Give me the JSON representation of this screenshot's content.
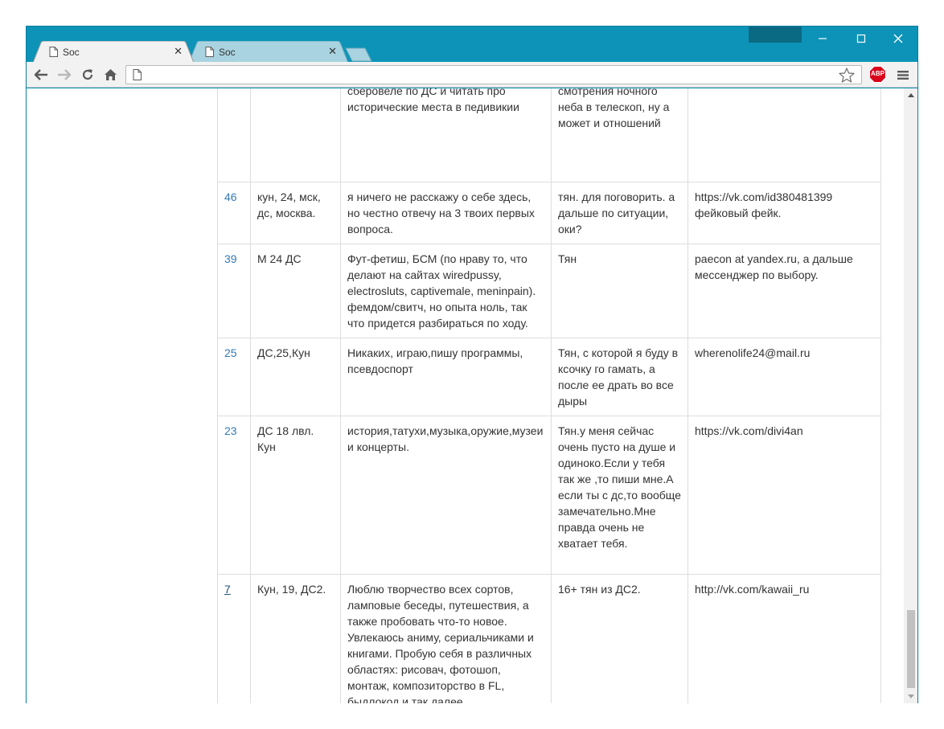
{
  "browser": {
    "tabs": [
      {
        "title": "Soc",
        "active": true
      },
      {
        "title": "Soc",
        "active": false
      }
    ],
    "new_tab_icon": "new-tab-icon",
    "address": {
      "value": "",
      "placeholder": ""
    },
    "adblock_label": "ABP",
    "colors": {
      "frame": "#0d93b8",
      "active_tab": "#f2f2f2",
      "inactive_tab": "#a9d3e0",
      "link": "#337ab7",
      "abp_red": "#d9001b"
    }
  },
  "table": {
    "rows": [
      {
        "id": "",
        "about": "",
        "interests": "музыка(гитарист), ездить на сберовеле по ДС и читать про исторические места в педивикии",
        "looking_for": "велопрогулок и смотрения ночного неба в телескоп, ну а может и отношений",
        "contact": ""
      },
      {
        "id": "46",
        "about": "кун, 24, мск, дс, москва.",
        "interests": "я ничего не расскажу о себе здесь, но честно отвечу на 3 твоих первых вопроса.",
        "looking_for": "тян. для поговорить. а дальше по ситуации, оки?",
        "contact": "https://vk.com/id380481399 фейковый фейк."
      },
      {
        "id": "39",
        "about": "М 24 ДС",
        "interests": "Фут-фетиш, БСМ (по нраву то, что делают на сайтах wiredpussy, electrosluts, captivemale, meninpain). фемдом/свитч, но опыта ноль, так что придется разбираться по ходу.",
        "looking_for": "Тян",
        "contact": "paecon at yandex.ru, а дальше мессенджер по выбору."
      },
      {
        "id": "25",
        "about": "ДС,25,Кун",
        "interests": "Никаких, играю,пишу программы, псевдоспорт",
        "looking_for": "Тян, с которой я буду в ксочку го гамать, а после ее драть во все дыры",
        "contact": "wherenolife24@mail.ru"
      },
      {
        "id": "23",
        "about": "ДС 18 лвл. Кун",
        "interests": "история,татухи,музыка,оружие,музеи и концерты.",
        "looking_for": "Тян.у меня сейчас очень пусто на душе и одиноко.Если у тебя так же ,то пиши мне.А если ты с дс,то вообще замечательно.Мне правда очень не хватает тебя.",
        "contact": "https://vk.com/divi4an"
      },
      {
        "id": "7",
        "about": "Кун, 19, ДС2.",
        "interests": "Люблю творчество всех сортов, ламповые беседы, путешествия, а также пробовать что-то новое. Увлекаюсь аниму, сериальчиками и книгами. Пробую себя в различных областях: рисовач, фотошоп, монтаж, композиторство в FL, быдлокод и так далее.",
        "looking_for": "16+ тян из ДС2.",
        "contact": "http://vk.com/kawaii_ru"
      }
    ]
  }
}
